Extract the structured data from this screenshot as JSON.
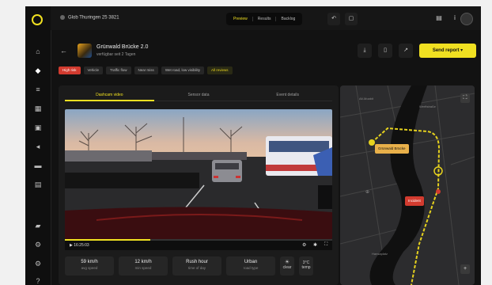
{
  "colors": {
    "accent": "#f0e021",
    "danger": "#d23b2f",
    "bg": "#121212"
  },
  "topbar": {
    "breadcrumb": "Glob Thuringen 25 3821",
    "segments": [
      {
        "label": "Preview",
        "active": true
      },
      {
        "label": "Results",
        "active": false
      },
      {
        "label": "Backlog",
        "active": false
      }
    ]
  },
  "header": {
    "title": "Grünwald Brücke 2.0",
    "subtitle": "verfügbar seit 2 Tagen",
    "primary_label": "Send report"
  },
  "chips": [
    {
      "label": "High risk",
      "kind": "red"
    },
    {
      "label": "Vehicle",
      "kind": ""
    },
    {
      "label": "Traffic flow",
      "kind": ""
    },
    {
      "label": "Near miss",
      "kind": ""
    },
    {
      "label": "Wet road, low visibility",
      "kind": ""
    },
    {
      "label": "All reviews",
      "kind": "yel"
    }
  ],
  "tabs": [
    {
      "label": "Dashcam video",
      "active": true
    },
    {
      "label": "Sensor data",
      "active": false
    },
    {
      "label": "Event details",
      "active": false
    }
  ],
  "video": {
    "timestamp": "16:25:03",
    "progress": 0.32
  },
  "stats": [
    {
      "value": "59 km/h",
      "label": "avg speed"
    },
    {
      "value": "12 km/h",
      "label": "min speed"
    },
    {
      "value": "Rush hour",
      "label": "time of day"
    },
    {
      "value": "Urban",
      "label": "road type"
    }
  ],
  "minis": [
    {
      "glyph": "☀",
      "label": "clear"
    },
    {
      "glyph": "3°C",
      "label": "temp"
    }
  ],
  "map": {
    "labels": [
      {
        "text": "Grünwald Brücke",
        "kind": "tag"
      },
      {
        "text": "Incident",
        "kind": "danger"
      }
    ],
    "street_labels": [
      "Alt-Moabit",
      "Werftstraße",
      "Spree",
      "Tiergarten",
      "Hansaplatz"
    ]
  }
}
